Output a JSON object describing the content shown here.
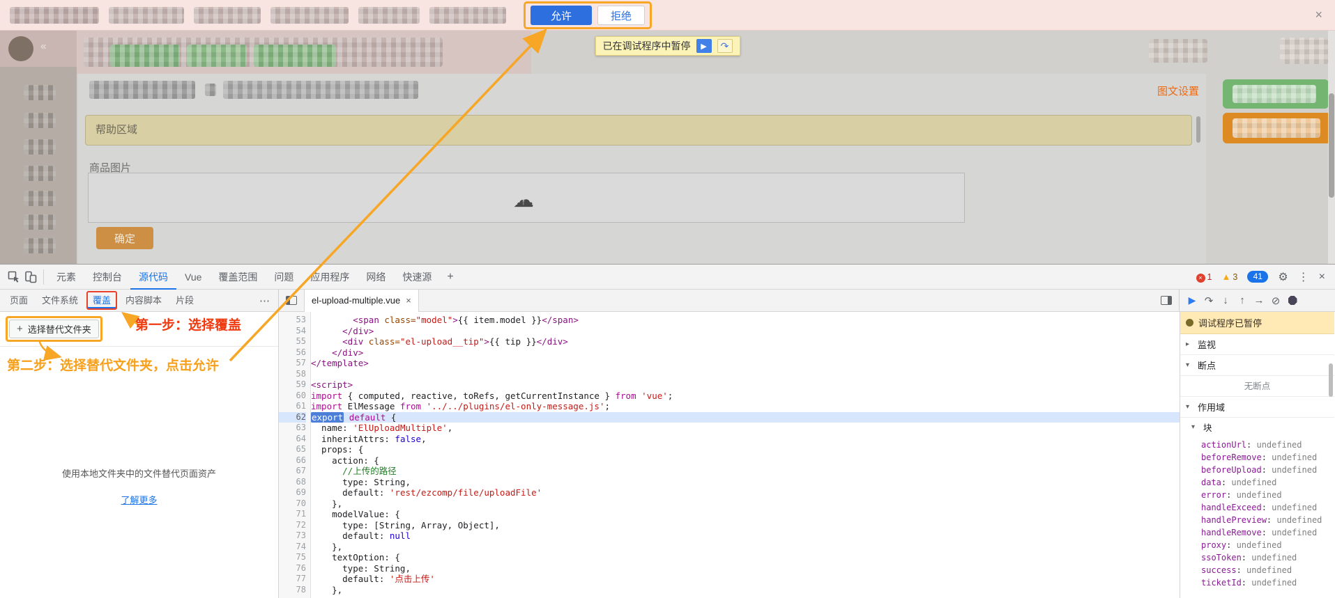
{
  "infobar": {
    "allow": "允许",
    "deny": "拒绝",
    "close": "×"
  },
  "page": {
    "paused_overlay": "已在调试程序中暂停",
    "settings_link": "图文设置",
    "help_area": "帮助区域",
    "product_image_label": "商品图片",
    "confirm": "确定"
  },
  "annotations": {
    "step1": "第一步：选择覆盖",
    "step2": "第二步：选择替代文件夹，点击允许"
  },
  "devtools": {
    "tabs": [
      "元素",
      "控制台",
      "源代码",
      "Vue",
      "覆盖范围",
      "问题",
      "应用程序",
      "网络",
      "快速源"
    ],
    "active_tab": "源代码",
    "more_tab": "+",
    "error_count": "1",
    "warning_count": "3",
    "issue_count": "41",
    "left_tabs": [
      "页面",
      "文件系统",
      "覆盖",
      "内容脚本",
      "片段"
    ],
    "active_left_tab": "覆盖",
    "left_more": "⋯",
    "overrides": {
      "select_folder_plus": "+",
      "select_folder": "选择替代文件夹",
      "hint": "使用本地文件夹中的文件替代页面资产",
      "learn_more": "了解更多"
    },
    "editor": {
      "file_tab": "el-upload-multiple.vue",
      "close": "×",
      "paused_line": 62,
      "lines": [
        {
          "n": 53,
          "t": [
            [
              "pl",
              "        "
            ],
            [
              "tag",
              "<span"
            ],
            [
              "attr",
              " class="
            ],
            [
              "str",
              "\"model\""
            ],
            [
              "tag",
              ">"
            ],
            [
              "pl",
              "{{ item.model }}"
            ],
            [
              "tag",
              "</span>"
            ]
          ]
        },
        {
          "n": 54,
          "t": [
            [
              "pl",
              "      "
            ],
            [
              "tag",
              "</div>"
            ]
          ]
        },
        {
          "n": 55,
          "t": [
            [
              "pl",
              "      "
            ],
            [
              "tag",
              "<div"
            ],
            [
              "attr",
              " class="
            ],
            [
              "str",
              "\"el-upload__tip\""
            ],
            [
              "tag",
              ">"
            ],
            [
              "pl",
              "{{ tip }}"
            ],
            [
              "tag",
              "</div>"
            ]
          ]
        },
        {
          "n": 56,
          "t": [
            [
              "pl",
              "    "
            ],
            [
              "tag",
              "</div>"
            ]
          ]
        },
        {
          "n": 57,
          "t": [
            [
              "tag",
              "</template>"
            ]
          ]
        },
        {
          "n": 58,
          "t": []
        },
        {
          "n": 59,
          "t": [
            [
              "tag",
              "<script>"
            ]
          ]
        },
        {
          "n": 60,
          "t": [
            [
              "kw",
              "import"
            ],
            [
              "pl",
              " { computed, reactive, toRefs, getCurrentInstance } "
            ],
            [
              "kw",
              "from"
            ],
            [
              "pl",
              " "
            ],
            [
              "str",
              "'vue'"
            ],
            [
              "pl",
              ";"
            ]
          ]
        },
        {
          "n": 61,
          "t": [
            [
              "kw",
              "import"
            ],
            [
              "pl",
              " ElMessage "
            ],
            [
              "kw",
              "from"
            ],
            [
              "pl",
              " "
            ],
            [
              "str",
              "'../../plugins/el-only-message.js'"
            ],
            [
              "pl",
              ";"
            ]
          ]
        },
        {
          "n": 62,
          "t": [
            [
              "kwx",
              "export"
            ],
            [
              "pl",
              " "
            ],
            [
              "kw",
              "default"
            ],
            [
              "pl",
              " {"
            ]
          ]
        },
        {
          "n": 63,
          "t": [
            [
              "pl",
              "  name: "
            ],
            [
              "str",
              "'ElUploadMultiple'"
            ],
            [
              "pl",
              ","
            ]
          ]
        },
        {
          "n": 64,
          "t": [
            [
              "pl",
              "  inheritAttrs: "
            ],
            [
              "atom",
              "false"
            ],
            [
              "pl",
              ","
            ]
          ]
        },
        {
          "n": 65,
          "t": [
            [
              "pl",
              "  props: {"
            ]
          ]
        },
        {
          "n": 66,
          "t": [
            [
              "pl",
              "    action: {"
            ]
          ]
        },
        {
          "n": 67,
          "t": [
            [
              "pl",
              "      "
            ],
            [
              "com",
              "//上传的路径"
            ]
          ]
        },
        {
          "n": 68,
          "t": [
            [
              "pl",
              "      type: String,"
            ]
          ]
        },
        {
          "n": 69,
          "t": [
            [
              "pl",
              "      default: "
            ],
            [
              "str",
              "'rest/ezcomp/file/uploadFile'"
            ]
          ]
        },
        {
          "n": 70,
          "t": [
            [
              "pl",
              "    },"
            ]
          ]
        },
        {
          "n": 71,
          "t": [
            [
              "pl",
              "    modelValue: {"
            ]
          ]
        },
        {
          "n": 72,
          "t": [
            [
              "pl",
              "      type: [String, Array, Object],"
            ]
          ]
        },
        {
          "n": 73,
          "t": [
            [
              "pl",
              "      default: "
            ],
            [
              "atom",
              "null"
            ]
          ]
        },
        {
          "n": 74,
          "t": [
            [
              "pl",
              "    },"
            ]
          ]
        },
        {
          "n": 75,
          "t": [
            [
              "pl",
              "    textOption: {"
            ]
          ]
        },
        {
          "n": 76,
          "t": [
            [
              "pl",
              "      type: String,"
            ]
          ]
        },
        {
          "n": 77,
          "t": [
            [
              "pl",
              "      default: "
            ],
            [
              "str",
              "'点击上传'"
            ]
          ]
        },
        {
          "n": 78,
          "t": [
            [
              "pl",
              "    },"
            ]
          ]
        }
      ]
    },
    "debugger": {
      "paused": "调试程序已暂停",
      "watch": "监视",
      "breakpoints": "断点",
      "no_breakpoints": "无断点",
      "scope": "作用域",
      "block": "块",
      "variables": [
        {
          "name": "actionUrl",
          "value": "undefined"
        },
        {
          "name": "beforeRemove",
          "value": "undefined"
        },
        {
          "name": "beforeUpload",
          "value": "undefined"
        },
        {
          "name": "data",
          "value": "undefined"
        },
        {
          "name": "error",
          "value": "undefined"
        },
        {
          "name": "handleExceed",
          "value": "undefined"
        },
        {
          "name": "handlePreview",
          "value": "undefined"
        },
        {
          "name": "handleRemove",
          "value": "undefined"
        },
        {
          "name": "proxy",
          "value": "undefined"
        },
        {
          "name": "ssoToken",
          "value": "undefined"
        },
        {
          "name": "success",
          "value": "undefined"
        },
        {
          "name": "ticketId",
          "value": "undefined"
        }
      ]
    }
  },
  "colors": {
    "accent_orange": "#f7a625",
    "annotation_red": "#e8402a",
    "devtools_blue": "#1a73e8"
  }
}
